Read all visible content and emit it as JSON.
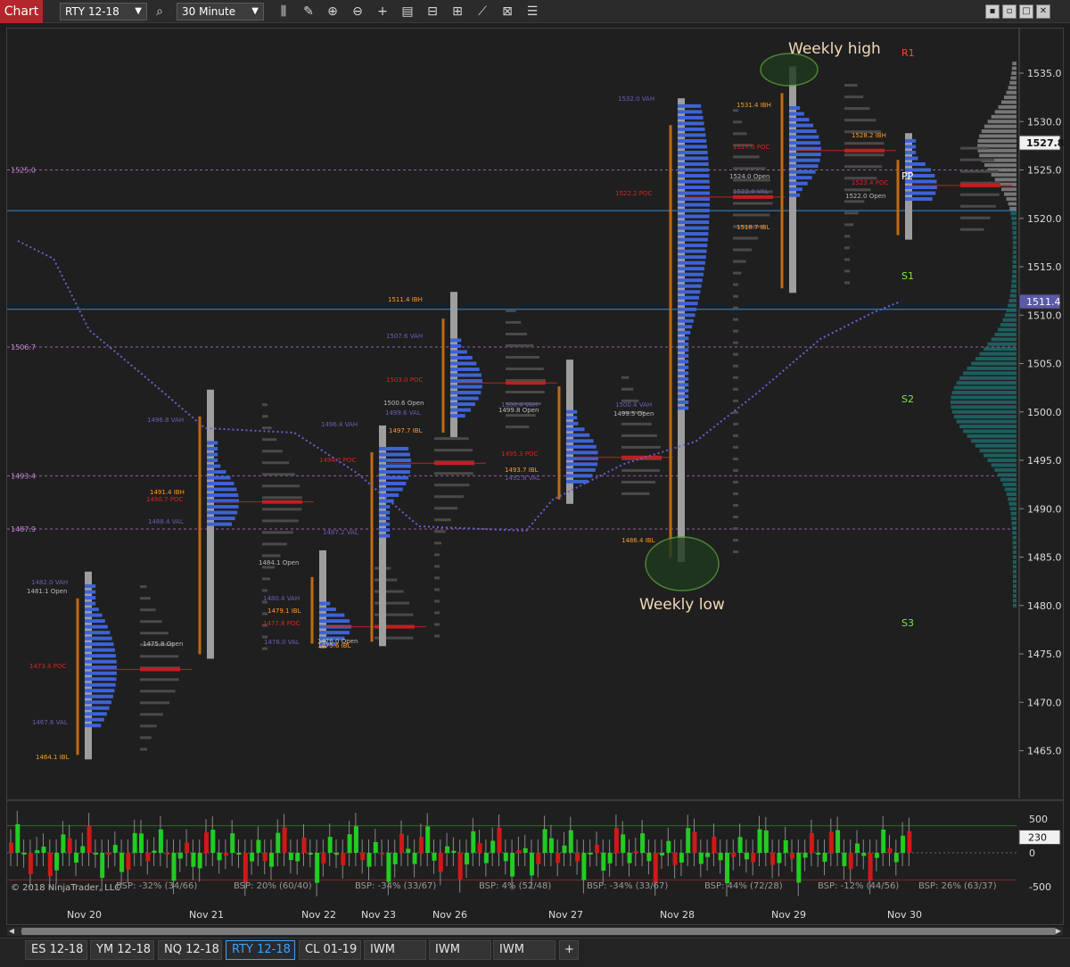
{
  "toolbar": {
    "title": "Chart",
    "instrument": "RTY 12-18",
    "interval": "30 Minute",
    "icons": [
      "search-icon",
      "bar-type-icon",
      "draw-icon",
      "zoom-in-icon",
      "zoom-out-icon",
      "crosshair-icon",
      "properties-icon",
      "data-box-icon",
      "templates-icon",
      "strategy-icon",
      "share-icon",
      "indicators-icon"
    ],
    "window_buttons": [
      "minimize",
      "restore",
      "maximize",
      "close"
    ]
  },
  "annotations": {
    "weekly_high": "Weekly high",
    "weekly_low": "Weekly low",
    "r1": "R1",
    "pp": "PP",
    "s1": "S1",
    "s2": "S2",
    "s3": "S3",
    "copyright": "© 2018 NinjaTrader, LLC"
  },
  "price_axis": {
    "ticks": [
      "1535.0",
      "1530.0",
      "1525.0",
      "1520.0",
      "1515.0",
      "1510.0",
      "1505.0",
      "1500.0",
      "1495.0",
      "1490.0",
      "1485.0",
      "1480.0",
      "1475.0",
      "1470.0",
      "1465.0"
    ],
    "last_price": "1527.8",
    "marker_price": "1511.4"
  },
  "left_levels": [
    "1525.0",
    "1506.7",
    "1493.4",
    "1487.9"
  ],
  "sub_axis": {
    "ticks": [
      "500",
      "0",
      "-500"
    ],
    "current": "230"
  },
  "bsp": [
    "BSP: -32% (34/66)",
    "BSP: 20% (60/40)",
    "BSP: -34% (33/67)",
    "BSP: 4% (52/48)",
    "BSP: -34% (33/67)",
    "BSP: 44% (72/28)",
    "BSP: -12% (44/56)",
    "BSP: 26% (63/37)"
  ],
  "dates": [
    "Nov 20",
    "Nov 21",
    "Nov 22",
    "Nov 23",
    "Nov 26",
    "Nov 27",
    "Nov 28",
    "Nov 29",
    "Nov 30"
  ],
  "profile_labels": [
    {
      "t": "1482.0 VAH",
      "c": "#6b5fb8"
    },
    {
      "t": "1481.1 Open",
      "c": "#bbbbbb"
    },
    {
      "t": "1473.4 POC",
      "c": "#e02020"
    },
    {
      "t": "1467.6 VAL",
      "c": "#6b5fb8"
    },
    {
      "t": "1464.1 IBL",
      "c": "#ff9a2e"
    },
    {
      "t": "1475.8 Open",
      "c": "#bbbbbb"
    },
    {
      "t": "1496.8 VAH",
      "c": "#6b5fb8"
    },
    {
      "t": "1491.4 IBH",
      "c": "#ff9a2e"
    },
    {
      "t": "1490.7 POC",
      "c": "#e02020"
    },
    {
      "t": "1488.4 VAL",
      "c": "#6b5fb8"
    },
    {
      "t": "1484.1 Open",
      "c": "#bbbbbb"
    },
    {
      "t": "1480.4 VAH",
      "c": "#6b5fb8"
    },
    {
      "t": "1479.1 IBL",
      "c": "#ff9a2e"
    },
    {
      "t": "1477.8 POC",
      "c": "#e02020"
    },
    {
      "t": "1476.0 VAL",
      "c": "#6b5fb8"
    },
    {
      "t": "1476.0 Open",
      "c": "#bbbbbb"
    },
    {
      "t": "1475.6 IBL",
      "c": "#ff9a2e"
    },
    {
      "t": "1496.4 VAH",
      "c": "#6b5fb8"
    },
    {
      "t": "1494.7 POC",
      "c": "#e02020"
    },
    {
      "t": "1487.2 VAL",
      "c": "#6b5fb8"
    },
    {
      "t": "1511.4 IBH",
      "c": "#ff9a2e"
    },
    {
      "t": "1507.6 VAH",
      "c": "#6b5fb8"
    },
    {
      "t": "1503.0 POC",
      "c": "#e02020"
    },
    {
      "t": "1500.6 Open",
      "c": "#bbbbbb"
    },
    {
      "t": "1499.6 VAL",
      "c": "#6b5fb8"
    },
    {
      "t": "1497.7 IBL",
      "c": "#ff9a2e"
    },
    {
      "t": "1500.4 VAH",
      "c": "#6b5fb8"
    },
    {
      "t": "1499.8 Open",
      "c": "#bbbbbb"
    },
    {
      "t": "1495.3 POC",
      "c": "#e02020"
    },
    {
      "t": "1493.7 IBL",
      "c": "#ff9a2e"
    },
    {
      "t": "1492.8 VAL",
      "c": "#6b5fb8"
    },
    {
      "t": "1532.0 VAH",
      "c": "#6b5fb8"
    },
    {
      "t": "1522.2 POC",
      "c": "#e02020"
    },
    {
      "t": "1500.4 VAH",
      "c": "#6b5fb8"
    },
    {
      "t": "1499.5 Open",
      "c": "#bbbbbb"
    },
    {
      "t": "1486.4 IBL",
      "c": "#ff9a2e"
    },
    {
      "t": "1531.4 IBH",
      "c": "#ff9a2e"
    },
    {
      "t": "1527.0 POC",
      "c": "#e02020"
    },
    {
      "t": "1524.0 Open",
      "c": "#bbbbbb"
    },
    {
      "t": "1522.4 VAL",
      "c": "#6b5fb8"
    },
    {
      "t": "1518.7 IBL",
      "c": "#ff9a2e"
    },
    {
      "t": "1528.2 IBH",
      "c": "#ff9a2e"
    },
    {
      "t": "1523.4 POC",
      "c": "#e02020"
    },
    {
      "t": "1522.0 Open",
      "c": "#bbbbbb"
    }
  ],
  "tabs": [
    "ES 12-18",
    "YM 12-18",
    "NQ 12-18",
    "RTY 12-18",
    "CL 01-19",
    "IWM",
    "IWM",
    "IWM"
  ],
  "active_tab": "RTY 12-18",
  "chart_data": {
    "type": "candlestick-market-profile",
    "price_range": [
      1461,
      1537
    ],
    "session_profiles": [
      {
        "date": "Nov 20",
        "high": 1483.5,
        "low": 1464.1,
        "poc": 1473.4,
        "vah": 1482.0,
        "val": 1467.6
      },
      {
        "date": "Nov 21",
        "high": 1502.3,
        "low": 1474.5,
        "poc": 1490.7,
        "vah": 1496.8,
        "val": 1488.4
      },
      {
        "date": "Nov 22",
        "high": 1485.7,
        "low": 1475.6,
        "poc": 1477.8,
        "vah": 1480.4,
        "val": 1476.0
      },
      {
        "date": "Nov 23",
        "high": 1498.6,
        "low": 1475.8,
        "poc": 1494.7,
        "vah": 1496.4,
        "val": 1487.2
      },
      {
        "date": "Nov 26",
        "high": 1512.4,
        "low": 1497.4,
        "poc": 1503.0,
        "vah": 1507.6,
        "val": 1499.6
      },
      {
        "date": "Nov 27",
        "high": 1505.4,
        "low": 1490.5,
        "poc": 1495.3,
        "vah": 1500.4,
        "val": 1492.8
      },
      {
        "date": "Nov 28",
        "high": 1532.4,
        "low": 1484.5,
        "poc": 1522.2,
        "vah": 1532.0,
        "val": 1500.4
      },
      {
        "date": "Nov 29",
        "high": 1535.7,
        "low": 1512.3,
        "poc": 1527.0,
        "vah": 1531.4,
        "val": 1522.4
      },
      {
        "date": "Nov 30",
        "high": 1528.8,
        "low": 1517.8,
        "poc": 1523.4,
        "vah": 1528.2,
        "val": 1522.0
      }
    ],
    "horizontal_lines": [
      1520.8,
      1510.6
    ],
    "dashed_levels": [
      1525.0,
      1506.7,
      1493.4,
      1487.9
    ],
    "pivots": {
      "R1": 1536,
      "PP": 1525,
      "S1": 1515,
      "S2": 1502,
      "S3": 1479
    },
    "volume_ylim": [
      -600,
      600
    ]
  }
}
